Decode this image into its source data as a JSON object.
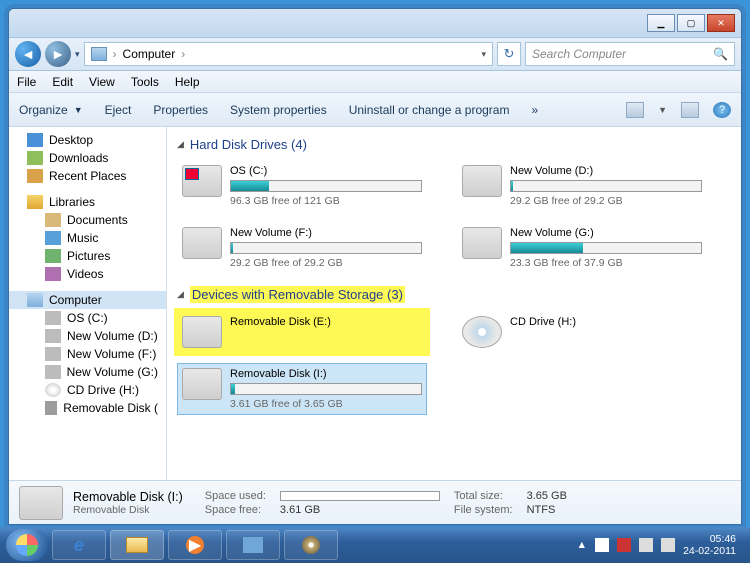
{
  "title": "Computer",
  "nav": {
    "back": "◄",
    "fwd": "►",
    "dropdown": "▾",
    "refresh": "↻"
  },
  "address": {
    "icon": "computer",
    "label": "Computer",
    "sep": "›"
  },
  "search": {
    "placeholder": "Search Computer",
    "icon": "🔍"
  },
  "menu": [
    "File",
    "Edit",
    "View",
    "Tools",
    "Help"
  ],
  "toolbar": {
    "items": [
      "Organize",
      "Eject",
      "Properties",
      "System properties",
      "Uninstall or change a program"
    ],
    "overflow": "»"
  },
  "sidebar": {
    "top": [
      {
        "icon": "desktop",
        "label": "Desktop"
      },
      {
        "icon": "download",
        "label": "Downloads"
      },
      {
        "icon": "recent",
        "label": "Recent Places"
      }
    ],
    "libraries": {
      "header": "Libraries",
      "items": [
        {
          "icon": "doc",
          "label": "Documents"
        },
        {
          "icon": "music",
          "label": "Music"
        },
        {
          "icon": "pic",
          "label": "Pictures"
        },
        {
          "icon": "vid",
          "label": "Videos"
        }
      ]
    },
    "computer": {
      "header": "Computer",
      "items": [
        {
          "icon": "hdd",
          "label": "OS (C:)"
        },
        {
          "icon": "hdd",
          "label": "New Volume (D:)"
        },
        {
          "icon": "hdd",
          "label": "New Volume (F:)"
        },
        {
          "icon": "hdd",
          "label": "New Volume (G:)"
        },
        {
          "icon": "cd",
          "label": "CD Drive (H:)"
        },
        {
          "icon": "usb",
          "label": "Removable Disk ("
        }
      ]
    }
  },
  "groups": {
    "hdd": {
      "title": "Hard Disk Drives (4)"
    },
    "rem": {
      "title": "Devices with Removable Storage (3)"
    }
  },
  "drives": {
    "c": {
      "title": "OS (C:)",
      "free": "96.3 GB free of 121 GB",
      "pct": 20
    },
    "d": {
      "title": "New Volume (D:)",
      "free": "29.2 GB free of 29.2 GB",
      "pct": 1
    },
    "f": {
      "title": "New Volume (F:)",
      "free": "29.2 GB free of 29.2 GB",
      "pct": 1
    },
    "g": {
      "title": "New Volume (G:)",
      "free": "23.3 GB free of 37.9 GB",
      "pct": 38
    },
    "e": {
      "title": "Removable Disk (E:)"
    },
    "h": {
      "title": "CD Drive (H:)"
    },
    "i": {
      "title": "Removable Disk (I:)",
      "free": "3.61 GB free of 3.65 GB",
      "pct": 2
    }
  },
  "details": {
    "title": "Removable Disk (I:)",
    "subtitle": "Removable Disk",
    "spaceUsedLabel": "Space used:",
    "spaceFreeLabel": "Space free:",
    "spaceFree": "3.61 GB",
    "totalSizeLabel": "Total size:",
    "totalSize": "3.65 GB",
    "fsLabel": "File system:",
    "fs": "NTFS"
  },
  "tray": {
    "time": "05:46",
    "date": "24-02-2011",
    "chevron": "▲"
  }
}
